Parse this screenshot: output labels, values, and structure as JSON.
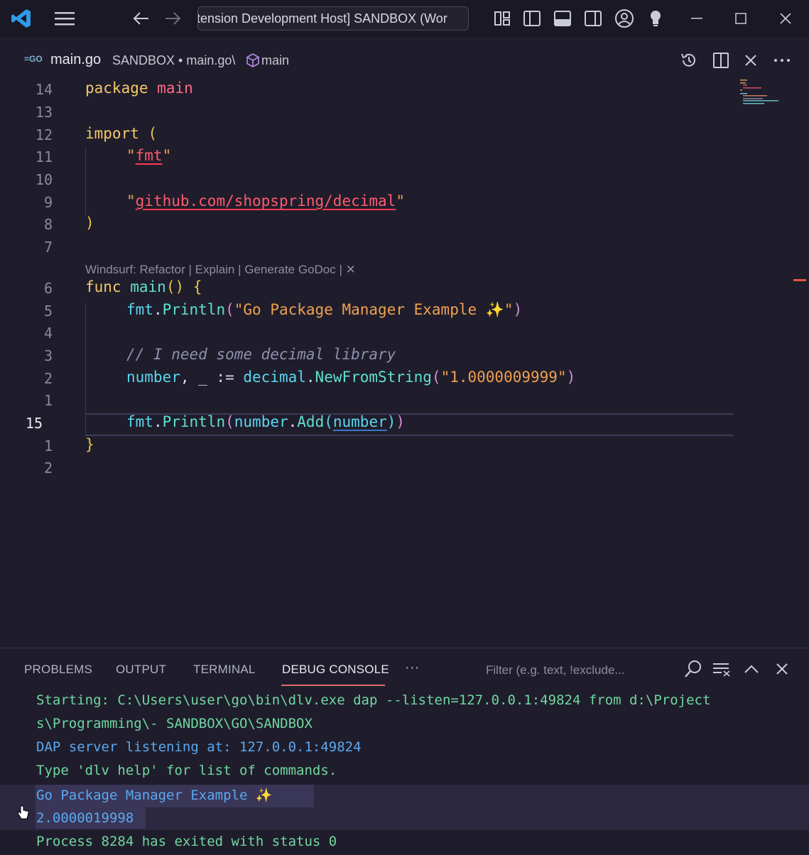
{
  "titlebar": {
    "title": "[Extension Development Host] SANDBOX (Wor"
  },
  "breadcrumb": {
    "go_badge": "=GO",
    "file": "main.go",
    "path": "SANDBOX • main.go\\",
    "symbol": "main"
  },
  "editor": {
    "line_numbers": [
      "14",
      "13",
      "12",
      "11",
      "10",
      "9",
      "8",
      "7",
      "6",
      "5",
      "4",
      "3",
      "2",
      "1",
      "15",
      "1",
      "2"
    ],
    "codelens": "Windsurf: Refactor | Explain | Generate GoDoc | ✕",
    "lines": {
      "l1_kw": "package",
      "l1_name": "main",
      "l3_kw": "import",
      "l3_paren": "(",
      "l4_q1": "\"",
      "l4_str": "fmt",
      "l4_q2": "\"",
      "l6_q1": "\"",
      "l6_str": "github.com/shopspring/decimal",
      "l6_q2": "\"",
      "l7_paren": ")",
      "l9_kw": "func",
      "l9_name": "main",
      "l9_rest": "()",
      "l9_brace": "{",
      "l10_pkg": "fmt",
      "l10_dot": ".",
      "l10_fn": "Println",
      "l10_open": "(",
      "l10_str": "\"Go Package Manager Example ✨\"",
      "l10_close": ")",
      "l12_comment": "// I need some decimal library",
      "l13_var": "number",
      "l13_mid": ", _ := ",
      "l13_pkg": "decimal",
      "l13_dot": ".",
      "l13_fn": "NewFromString",
      "l13_open": "(",
      "l13_str": "\"1.0000009999\"",
      "l13_close": ")",
      "l15_pkg": "fmt",
      "l15_dot": ".",
      "l15_fn": "Println",
      "l15_open": "(",
      "l15_var": "number",
      "l15_dot2": ".",
      "l15_fn2": "Add",
      "l15_open2": "(",
      "l15_arg": "number",
      "l15_close2": ")",
      "l15_close": ")",
      "l16_brace": "}"
    }
  },
  "panel": {
    "tabs": [
      "PROBLEMS",
      "OUTPUT",
      "TERMINAL",
      "DEBUG CONSOLE"
    ],
    "more": "···",
    "filter_placeholder": "Filter (e.g. text, !exclude...",
    "console_lines": [
      "Starting: C:\\Users\\user\\go\\bin\\dlv.exe dap --listen=127.0.0.1:49824 from d:\\Project",
      "s\\Programming\\- SANDBOX\\GO\\SANDBOX",
      "DAP server listening at: 127.0.0.1:49824",
      "Type 'dlv help' for list of commands.",
      "Go Package Manager Example ✨",
      "2.0000019998",
      "Process 8284 has exited with status 0"
    ]
  },
  "colors": {
    "background": "#1f1d2b",
    "keyword": "#f5c86b",
    "string": "#f0a050",
    "function": "#5fe0d0",
    "console_green": "#6fd6a0",
    "console_blue": "#5aa8f0"
  }
}
